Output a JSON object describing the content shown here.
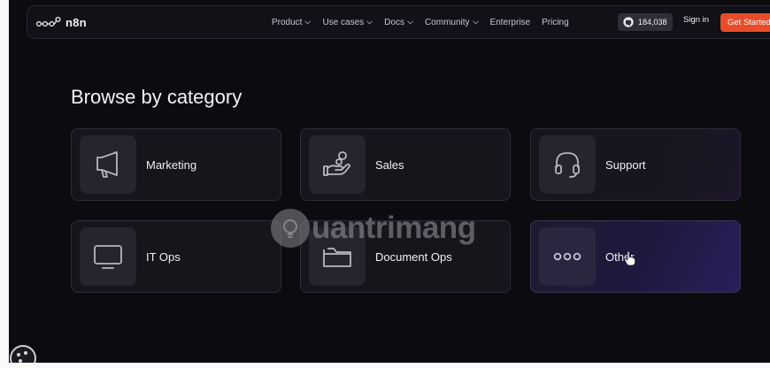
{
  "nav": {
    "logo_text": "n8n",
    "menu": [
      {
        "label": "Product",
        "dropdown": true
      },
      {
        "label": "Use cases",
        "dropdown": true
      },
      {
        "label": "Docs",
        "dropdown": true
      },
      {
        "label": "Community",
        "dropdown": true
      },
      {
        "label": "Enterprise",
        "dropdown": false
      },
      {
        "label": "Pricing",
        "dropdown": false
      }
    ],
    "github_stars": "184,038",
    "signin_label": "Sign in",
    "cta_label": "Get Started"
  },
  "main": {
    "heading": "Browse by category",
    "categories": [
      {
        "label": "Marketing",
        "icon": "megaphone-icon"
      },
      {
        "label": "Sales",
        "icon": "hand-coins-icon"
      },
      {
        "label": "Support",
        "icon": "headset-icon"
      },
      {
        "label": "IT Ops",
        "icon": "monitor-icon"
      },
      {
        "label": "Document Ops",
        "icon": "folder-icon"
      },
      {
        "label": "Other",
        "icon": "dots-icon"
      }
    ]
  },
  "watermark": {
    "text": "uantrimang"
  },
  "colors": {
    "background": "#0c0b10",
    "card": "#16151c",
    "accent": "#ea4b28",
    "other_card": "#1e1940"
  }
}
